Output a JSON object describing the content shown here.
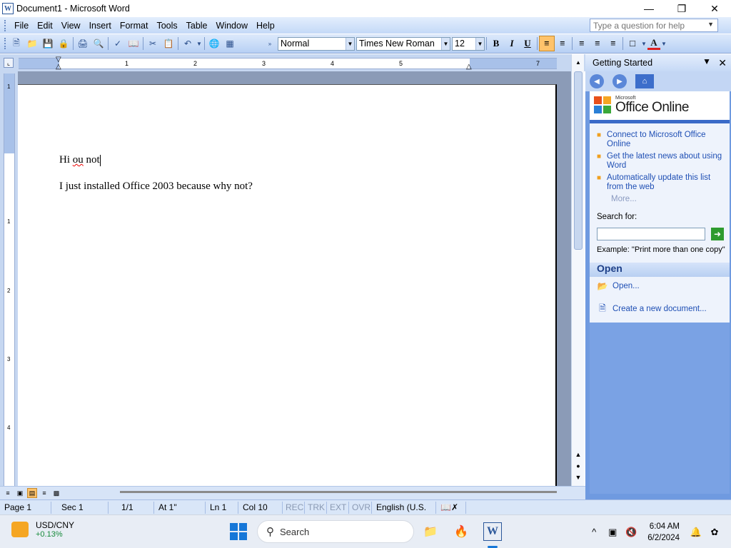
{
  "window": {
    "title": "Document1 - Microsoft Word",
    "app_icon": "W"
  },
  "menu": {
    "items": [
      {
        "label": "File",
        "key": "F"
      },
      {
        "label": "Edit",
        "key": "E"
      },
      {
        "label": "View",
        "key": "V"
      },
      {
        "label": "Insert",
        "key": "I"
      },
      {
        "label": "Format",
        "key": "o"
      },
      {
        "label": "Tools",
        "key": "T"
      },
      {
        "label": "Table",
        "key": "a"
      },
      {
        "label": "Window",
        "key": "W"
      },
      {
        "label": "Help",
        "key": "H"
      }
    ],
    "help_placeholder": "Type a question for help"
  },
  "toolbar": {
    "style": "Normal",
    "font": "Times New Roman",
    "size": "12",
    "bold": "B",
    "italic": "I",
    "underline": "U",
    "font_color": "#e02020"
  },
  "ruler": {
    "numbers": [
      "1",
      "2",
      "3",
      "4",
      "5",
      "7"
    ]
  },
  "vruler": {
    "numbers": [
      "1",
      "1",
      "2",
      "3",
      "4"
    ]
  },
  "document": {
    "line1_prefix": "Hi ",
    "line1_misspelled": "ou",
    "line1_suffix": " not",
    "line2": "I just installed Office 2003 because why not?"
  },
  "status": {
    "page": "Page 1",
    "sec": "Sec 1",
    "pages": "1/1",
    "at": "At 1\"",
    "ln": "Ln 1",
    "col": "Col 10",
    "rec": "REC",
    "trk": "TRK",
    "ext": "EXT",
    "ovr": "OVR",
    "language": "English (U.S."
  },
  "taskpane": {
    "title": "Getting Started",
    "logo_small": "Microsoft",
    "logo_big": "Office Online",
    "links": [
      "Connect to Microsoft Office Online",
      "Get the latest news about using Word",
      "Automatically update this list from the web"
    ],
    "more": "More...",
    "search_label": "Search for:",
    "example": "Example:  \"Print more than one copy\"",
    "open_heading": "Open",
    "open_link": "Open...",
    "create_link": "Create a new document..."
  },
  "taskbar": {
    "ticker_label": "USD/CNY",
    "ticker_change": "+0.13%",
    "search_label": "Search",
    "time": "6:04 AM",
    "date": "6/2/2024"
  },
  "colors": {
    "accent": "#2b579a",
    "task_pane_blue": "#6f9ae0",
    "highlight": "#ffc36b"
  }
}
